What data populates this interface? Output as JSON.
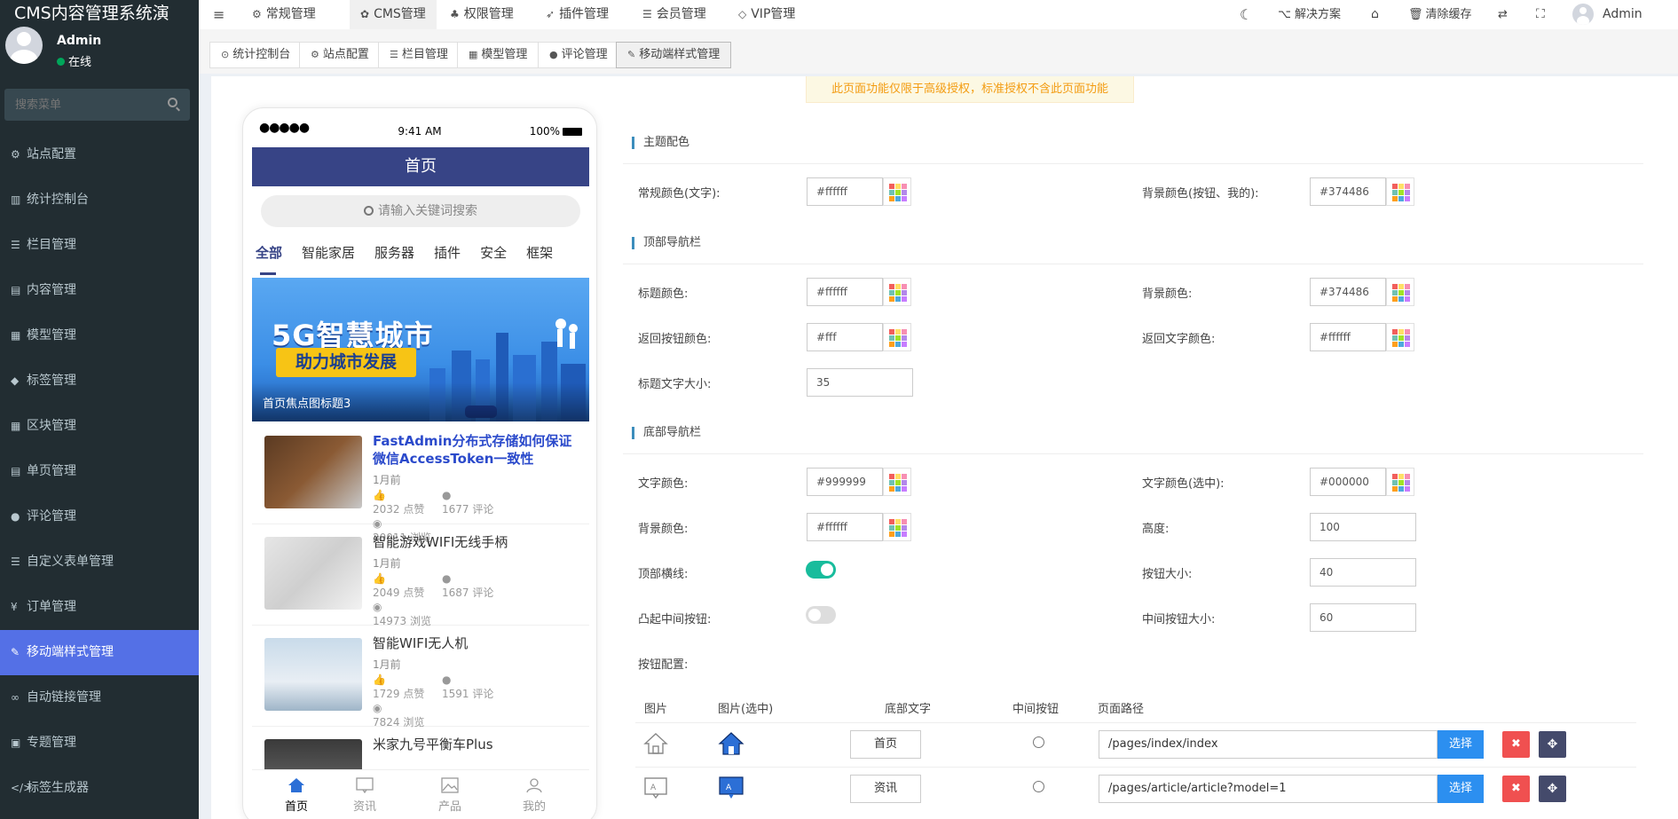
{
  "app": {
    "title": "CMS内容管理系统演"
  },
  "user": {
    "name": "Admin",
    "status": "在线"
  },
  "sidebar": {
    "search_placeholder": "搜索菜单",
    "items": [
      {
        "icon": "⚙",
        "label": "站点配置"
      },
      {
        "icon": "▥",
        "label": "统计控制台"
      },
      {
        "icon": "☰",
        "label": "栏目管理"
      },
      {
        "icon": "▤",
        "label": "内容管理"
      },
      {
        "icon": "▦",
        "label": "模型管理"
      },
      {
        "icon": "◆",
        "label": "标签管理"
      },
      {
        "icon": "▦",
        "label": "区块管理"
      },
      {
        "icon": "▤",
        "label": "单页管理"
      },
      {
        "icon": "●",
        "label": "评论管理"
      },
      {
        "icon": "☰",
        "label": "自定义表单管理"
      },
      {
        "icon": "¥",
        "label": "订单管理"
      },
      {
        "icon": "✎",
        "label": "移动端样式管理"
      },
      {
        "icon": "∞",
        "label": "自动链接管理"
      },
      {
        "icon": "▣",
        "label": "专题管理"
      },
      {
        "icon": "</>",
        "label": "标签生成器"
      }
    ]
  },
  "topnav": {
    "menu_icon": "≡",
    "items": [
      {
        "icon": "⚙",
        "label": "常规管理"
      },
      {
        "icon": "✿",
        "label": "CMS管理"
      },
      {
        "icon": "♣",
        "label": "权限管理"
      },
      {
        "icon": "➶",
        "label": "插件管理"
      },
      {
        "icon": "☰",
        "label": "会员管理"
      },
      {
        "icon": "◇",
        "label": "VIP管理"
      }
    ],
    "right": {
      "theme_icon": "☾",
      "solution": "解决方案",
      "home_icon": "⌂",
      "clear_cache": "清除缓存",
      "lang_icon": "⇄",
      "fullscreen_icon": "⛶",
      "admin": "Admin"
    }
  },
  "subtabs": [
    {
      "icon": "⊙",
      "label": "统计控制台"
    },
    {
      "icon": "⚙",
      "label": "站点配置"
    },
    {
      "icon": "☰",
      "label": "栏目管理"
    },
    {
      "icon": "▦",
      "label": "模型管理"
    },
    {
      "icon": "●",
      "label": "评论管理"
    },
    {
      "icon": "✎",
      "label": "移动端样式管理"
    }
  ],
  "notice": "此页面功能仅限于高级授权，标准授权不含此页面功能",
  "phone": {
    "signal": "●●●●●",
    "time": "9:41 AM",
    "battery": "100%",
    "header": "首页",
    "search_placeholder": "请输入关键词搜索",
    "tabs": [
      "全部",
      "智能家居",
      "服务器",
      "插件",
      "安全",
      "框架"
    ],
    "banner": {
      "title": "5G智慧城市",
      "subtitle": "助力城市发展",
      "caption": "首页焦点图标题3"
    },
    "news": [
      {
        "title": "FastAdmin分布式存储如何保证微信AccessToken一致性",
        "time": "1月前",
        "likes": "2032 点赞",
        "comments": "1677 评论",
        "views": "20011 浏览"
      },
      {
        "title": "智能游戏WIFI无线手柄",
        "time": "1月前",
        "likes": "2049 点赞",
        "comments": "1687 评论",
        "views": "14973 浏览"
      },
      {
        "title": "智能WIFI无人机",
        "time": "1月前",
        "likes": "1729 点赞",
        "comments": "1591 评论",
        "views": "7824 浏览"
      },
      {
        "title": "米家九号平衡车Plus"
      }
    ],
    "bottom": [
      "首页",
      "资讯",
      "产品",
      "我的"
    ]
  },
  "form": {
    "sections": {
      "theme": "主题配色",
      "topnav": "顶部导航栏",
      "bottomnav": "底部导航栏"
    },
    "theme": {
      "text_color_label": "常规颜色(文字):",
      "text_color": "#ffffff",
      "bg_color_label": "背景颜色(按钮、我的):",
      "bg_color": "#374486"
    },
    "top": {
      "title_color_label": "标题颜色:",
      "title_color": "#ffffff",
      "bg_color_label": "背景颜色:",
      "bg_color": "#374486",
      "back_btn_color_label": "返回按钮颜色:",
      "back_btn_color": "#fff",
      "back_text_color_label": "返回文字颜色:",
      "back_text_color": "#ffffff",
      "title_size_label": "标题文字大小:",
      "title_size": "35"
    },
    "bottom": {
      "text_color_label": "文字颜色:",
      "text_color": "#999999",
      "text_color_sel_label": "文字颜色(选中):",
      "text_color_sel": "#000000",
      "bg_color_label": "背景颜色:",
      "bg_color": "#ffffff",
      "height_label": "高度:",
      "height": "100",
      "top_line_label": "顶部横线:",
      "top_line": true,
      "btn_size_label": "按钮大小:",
      "btn_size": "40",
      "raised_mid_label": "凸起中间按钮:",
      "raised_mid": false,
      "mid_btn_size_label": "中间按钮大小:",
      "mid_btn_size": "60",
      "btn_config_label": "按钮配置:"
    },
    "table": {
      "headers": [
        "图片",
        "图片(选中)",
        "底部文字",
        "中间按钮",
        "页面路径"
      ],
      "rows": [
        {
          "text": "首页",
          "path": "/pages/index/index"
        },
        {
          "text": "资讯",
          "path": "/pages/article/article?model=1"
        }
      ],
      "select_label": "选择",
      "delete_icon": "✖",
      "move_icon": "✥"
    }
  },
  "colors": {
    "sidebar_bg": "#222d32",
    "active_menu": "#5470e6",
    "theme": "#374486",
    "select_btn": "#2c8ff0",
    "toggle_on": "#18bc9c"
  }
}
